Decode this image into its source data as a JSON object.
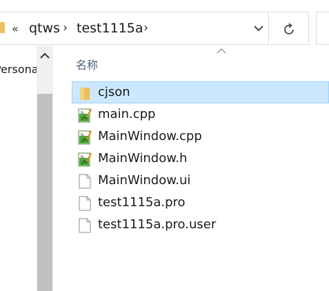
{
  "address_bar": {
    "overflow_label": "«",
    "breadcrumbs": [
      {
        "label": "qtws"
      },
      {
        "label": "test1115a"
      }
    ],
    "separator": "›"
  },
  "nav_pane": {
    "items": [
      {
        "label": "Personal"
      }
    ]
  },
  "file_list": {
    "column_name": "名称",
    "files": [
      {
        "name": "cjson",
        "icon": "folder-icon",
        "selected": true
      },
      {
        "name": "main.cpp",
        "icon": "cpp-source-icon",
        "selected": false
      },
      {
        "name": "MainWindow.cpp",
        "icon": "cpp-source-icon",
        "selected": false
      },
      {
        "name": "MainWindow.h",
        "icon": "cpp-source-icon",
        "selected": false
      },
      {
        "name": "MainWindow.ui",
        "icon": "generic-file-icon",
        "selected": false
      },
      {
        "name": "test1115a.pro",
        "icon": "generic-file-icon",
        "selected": false
      },
      {
        "name": "test1115a.pro.user",
        "icon": "generic-file-icon",
        "selected": false
      }
    ]
  },
  "colors": {
    "selection_bg": "#cce8ff",
    "selection_border": "#99d1ff",
    "folder": "#e8c15c",
    "header_text": "#4d6082"
  }
}
